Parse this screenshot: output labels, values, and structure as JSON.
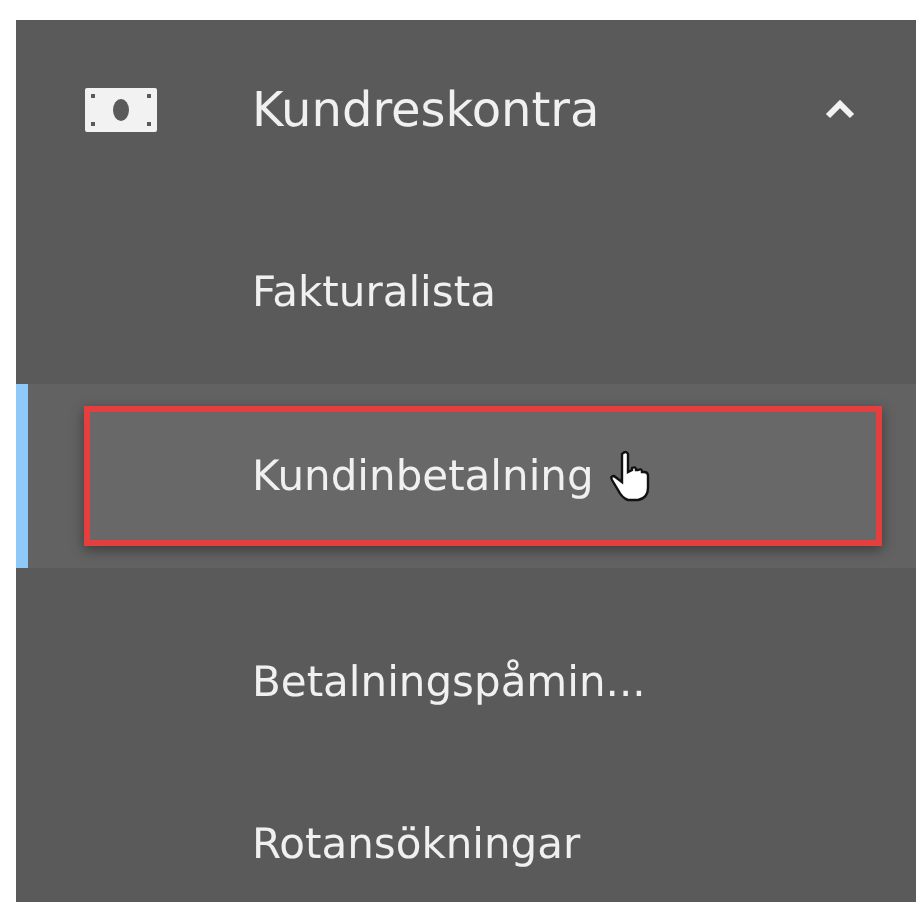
{
  "menu": {
    "title": "Kundreskontra",
    "expanded": true,
    "items": [
      {
        "label": "Fakturalista",
        "selected": false,
        "highlighted": false
      },
      {
        "label": "Kundinbetalning",
        "selected": true,
        "highlighted": true
      },
      {
        "label": "Betalningspåmin...",
        "selected": false,
        "highlighted": false
      },
      {
        "label": "Rotansökningar",
        "selected": false,
        "highlighted": false
      }
    ]
  }
}
